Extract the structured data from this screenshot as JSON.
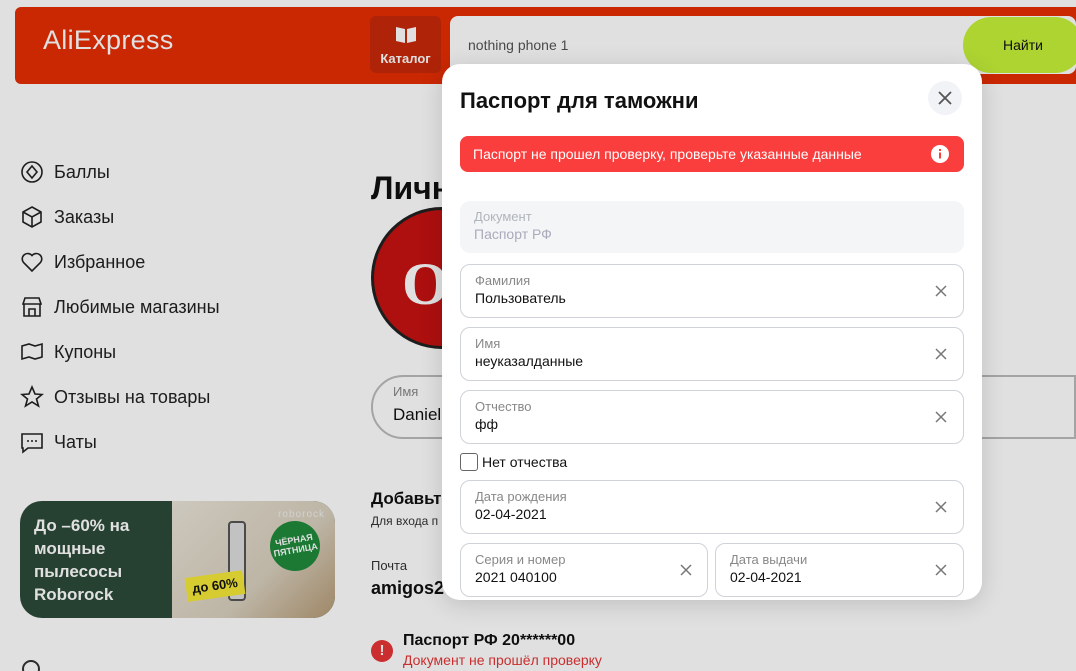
{
  "header": {
    "logo": "AliExpress",
    "catalog_label": "Каталог",
    "search_value": "nothing phone 1",
    "search_button": "Найти"
  },
  "sidebar": {
    "items": [
      {
        "label": "Баллы",
        "icon": "points-icon"
      },
      {
        "label": "Заказы",
        "icon": "box-icon"
      },
      {
        "label": "Избранное",
        "icon": "heart-icon"
      },
      {
        "label": "Любимые магазины",
        "icon": "store-icon"
      },
      {
        "label": "Купоны",
        "icon": "coupon-icon"
      },
      {
        "label": "Отзывы на товары",
        "icon": "star-icon"
      },
      {
        "label": "Чаты",
        "icon": "chat-icon"
      }
    ],
    "promo": {
      "text": "До –60% на мощные пылесосы Roborock",
      "brand": "roborock",
      "badge": "ЧЁРНАЯ ПЯТНИЦА",
      "discount": "до 60%"
    }
  },
  "background": {
    "title": "Личн",
    "avatar_letter": "O",
    "name_label": "Имя",
    "name_value": "Daniel",
    "add_title": "Добавьт",
    "add_sub": "Для входа п",
    "mail_label": "Почта",
    "mail_value": "amigos2",
    "passport_title": "Паспорт РФ 20******00",
    "passport_status": "Документ не прошёл проверку"
  },
  "modal": {
    "title": "Паспорт для таможни",
    "error": "Паспорт не прошел проверку, проверьте указанные данные",
    "document_label": "Документ",
    "document_value": "Паспорт РФ",
    "surname_label": "Фамилия",
    "surname_value": "Пользователь",
    "name_label": "Имя",
    "name_value": "неуказалданные",
    "patronymic_label": "Отчество",
    "patronymic_value": "фф",
    "no_patronymic_label": "Нет отчества",
    "birth_label": "Дата рождения",
    "birth_value": "02-04-2021",
    "series_label": "Серия и номер",
    "series_value": "2021 040100",
    "issue_label": "Дата выдачи",
    "issue_value": "02-04-2021"
  },
  "colors": {
    "brand_red": "#e62e04",
    "search_button": "#c6f23a",
    "error_red": "#fa3d3d"
  }
}
